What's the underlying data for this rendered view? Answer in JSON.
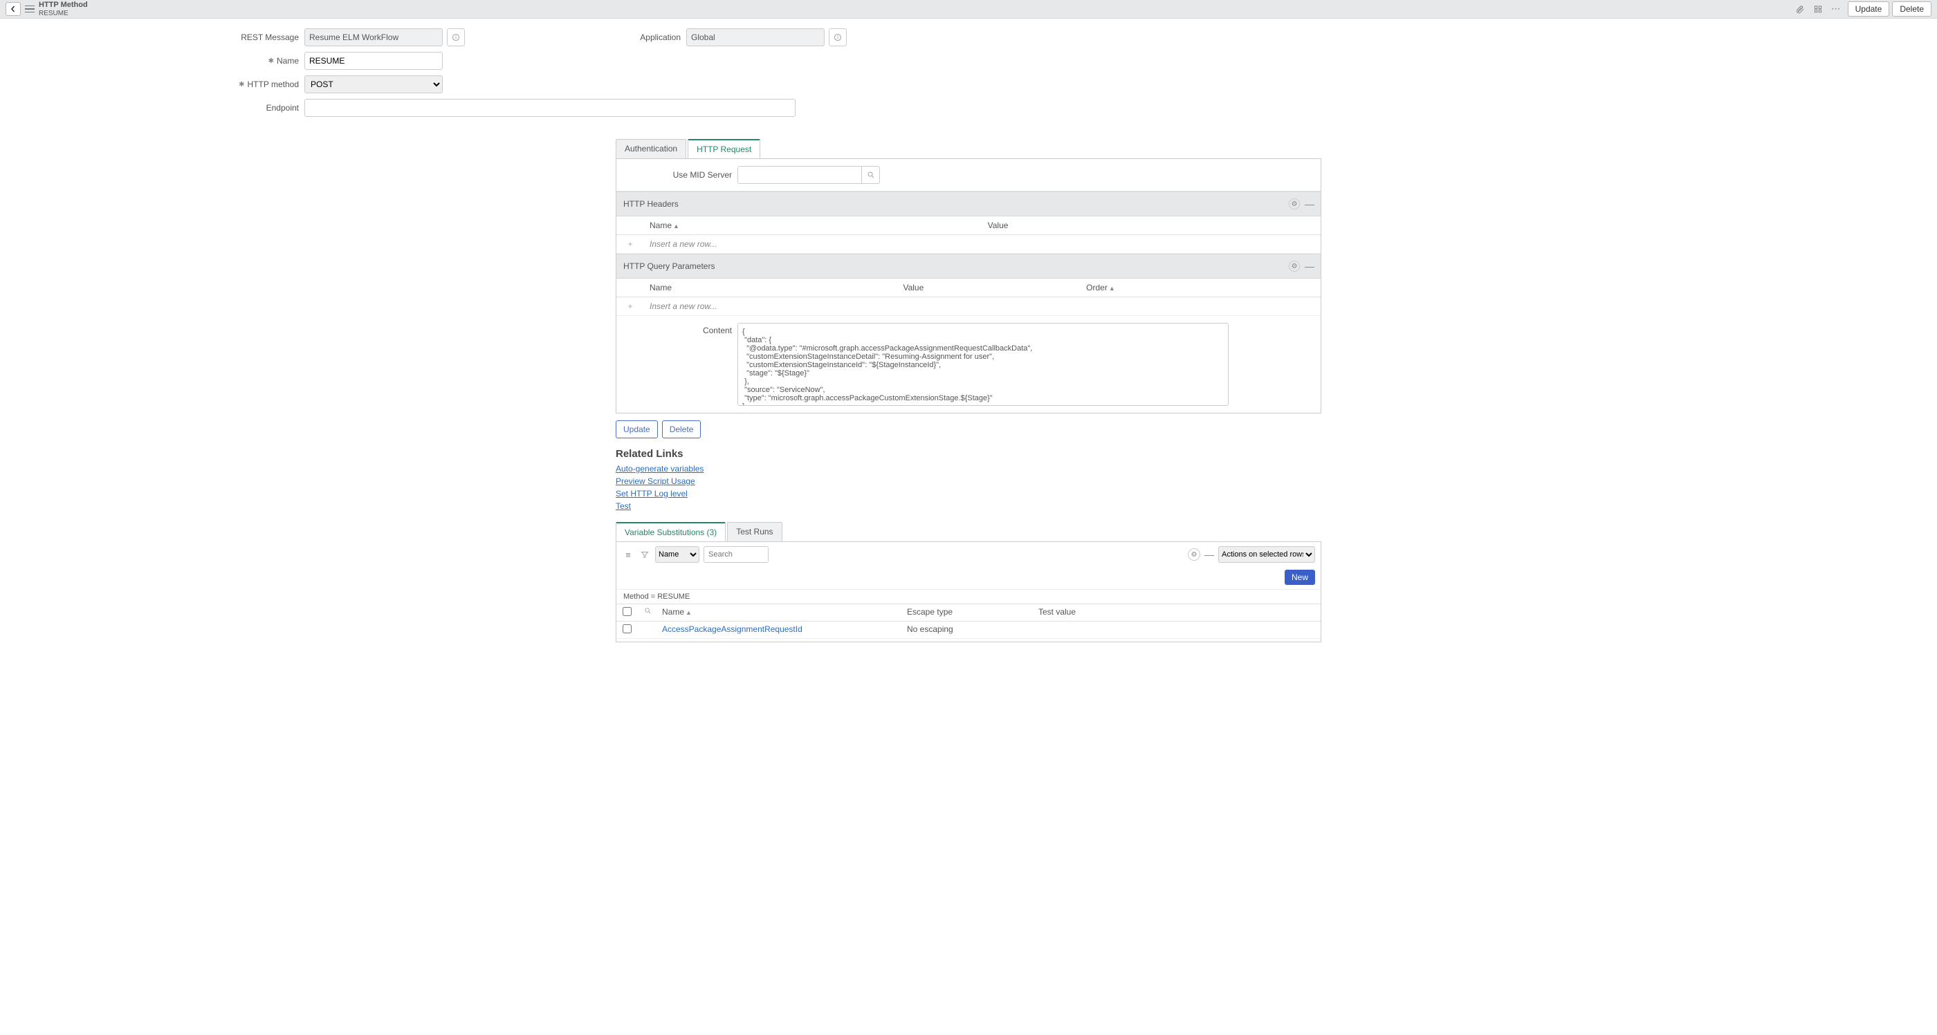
{
  "header": {
    "title": "HTTP Method",
    "record": "RESUME",
    "update": "Update",
    "delete": "Delete"
  },
  "form": {
    "restMessage": {
      "label": "REST Message",
      "value": "Resume ELM WorkFlow"
    },
    "application": {
      "label": "Application",
      "value": "Global"
    },
    "name": {
      "label": "Name",
      "value": "RESUME"
    },
    "httpMethod": {
      "label": "HTTP method",
      "value": "POST"
    },
    "endpoint": {
      "label": "Endpoint",
      "value": ""
    }
  },
  "tabs": {
    "auth": "Authentication",
    "req": "HTTP Request"
  },
  "midServer": {
    "label": "Use MID Server",
    "value": ""
  },
  "sections": {
    "headers": {
      "title": "HTTP Headers",
      "cols": {
        "name": "Name",
        "value": "Value"
      },
      "insert": "Insert a new row..."
    },
    "query": {
      "title": "HTTP Query Parameters",
      "cols": {
        "name": "Name",
        "value": "Value",
        "order": "Order"
      },
      "insert": "Insert a new row..."
    }
  },
  "content": {
    "label": "Content",
    "value": "{\n \"data\": {\n  \"@odata.type\": \"#microsoft.graph.accessPackageAssignmentRequestCallbackData\",\n  \"customExtensionStageInstanceDetail\": \"Resuming-Assignment for user\",\n  \"customExtensionStageInstanceId\": \"${StageInstanceId}\",\n  \"stage\": \"${Stage}\"\n },\n \"source\": \"ServiceNow\",\n \"type\": \"microsoft.graph.accessPackageCustomExtensionStage.${Stage}\"\n}"
  },
  "buttons": {
    "update": "Update",
    "delete": "Delete"
  },
  "related": {
    "title": "Related Links",
    "links": [
      "Auto-generate variables",
      "Preview Script Usage",
      "Set HTTP Log level",
      "Test"
    ]
  },
  "lowerTabs": {
    "vars": "Variable Substitutions (3)",
    "runs": "Test Runs"
  },
  "listToolbar": {
    "searchField": "Name",
    "searchPlaceholder": "Search",
    "actions": "Actions on selected rows...",
    "newBtn": "New"
  },
  "breadcrumb": "Method = RESUME",
  "listCols": {
    "name": "Name",
    "escape": "Escape type",
    "test": "Test value"
  },
  "listRows": [
    {
      "name": "AccessPackageAssignmentRequestId",
      "escape": "No escaping",
      "test": ""
    }
  ]
}
